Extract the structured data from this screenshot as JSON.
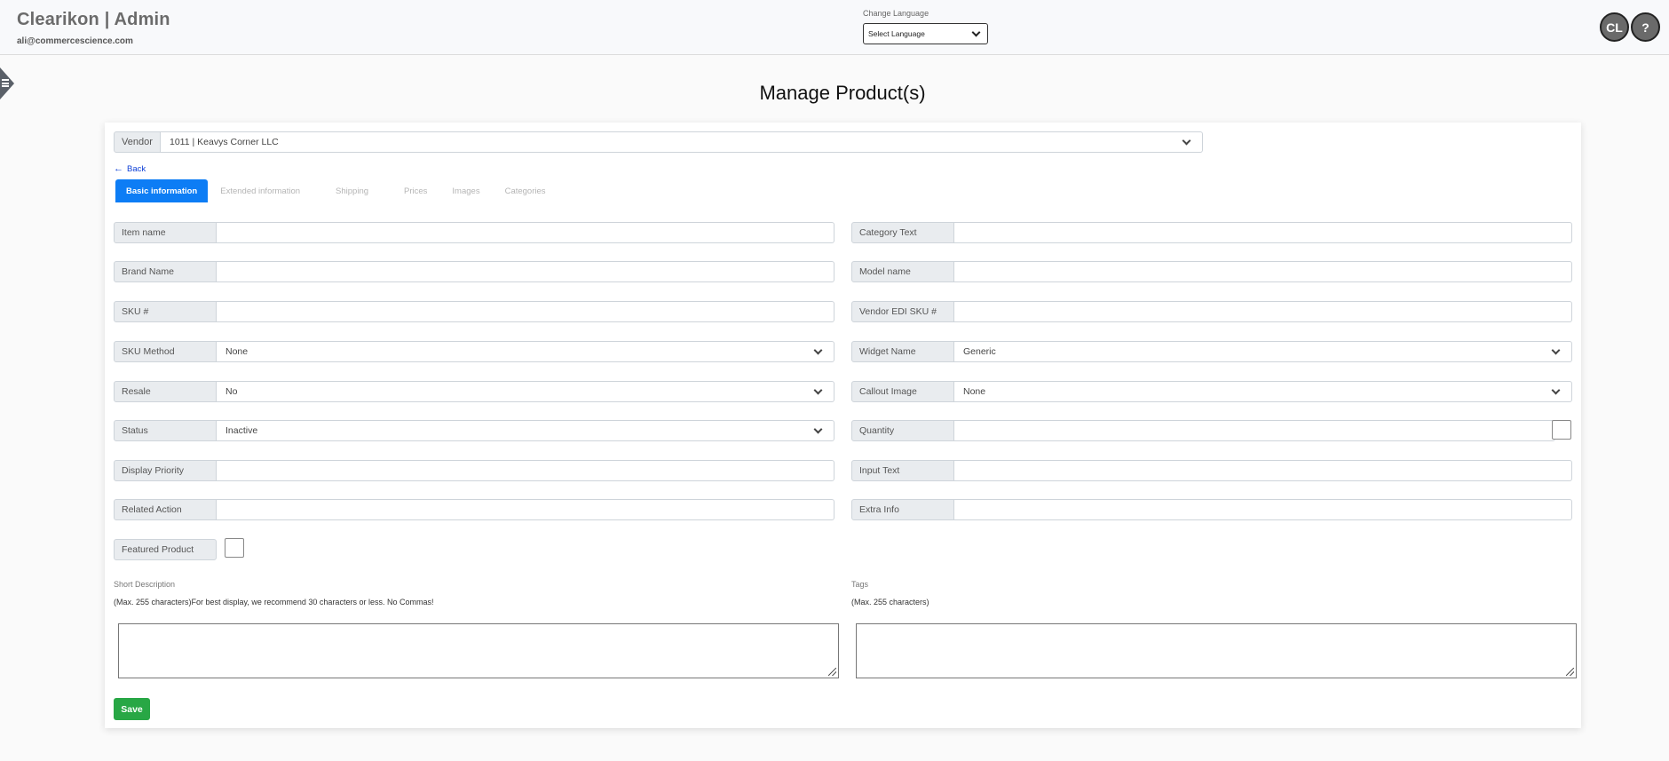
{
  "header": {
    "title": "Clearikon | Admin",
    "email": "ali@commercescience.com",
    "language_label": "Change Language",
    "language_select": "Select Language",
    "avatar_initials": "CL",
    "help_label": "?"
  },
  "page": {
    "title": "Manage Product(s)"
  },
  "vendor": {
    "label": "Vendor",
    "value": "1011 | Keavys Corner LLC"
  },
  "back_label": "Back",
  "tabs": [
    {
      "label": "Basic information",
      "active": true
    },
    {
      "label": "Extended information",
      "active": false
    },
    {
      "label": "Shipping",
      "active": false
    },
    {
      "label": "Prices",
      "active": false
    },
    {
      "label": "Images",
      "active": false
    },
    {
      "label": "Categories",
      "active": false
    }
  ],
  "fields_left": [
    {
      "label": "Item name",
      "type": "text",
      "value": ""
    },
    {
      "label": "Brand Name",
      "type": "text",
      "value": ""
    },
    {
      "label": "SKU #",
      "type": "text",
      "value": ""
    },
    {
      "label": "SKU Method",
      "type": "select",
      "value": "None"
    },
    {
      "label": "Resale",
      "type": "select",
      "value": "No"
    },
    {
      "label": "Status",
      "type": "select",
      "value": "Inactive"
    },
    {
      "label": "Display Priority",
      "type": "text",
      "value": ""
    },
    {
      "label": "Related Action",
      "type": "text",
      "value": ""
    }
  ],
  "fields_right": [
    {
      "label": "Category Text",
      "type": "text",
      "value": ""
    },
    {
      "label": "Model name",
      "type": "text",
      "value": ""
    },
    {
      "label": "Vendor EDI SKU #",
      "type": "text",
      "value": ""
    },
    {
      "label": "Widget Name",
      "type": "select",
      "value": "Generic"
    },
    {
      "label": "Callout Image",
      "type": "select",
      "value": "None"
    },
    {
      "label": "Quantity",
      "type": "text",
      "value": ""
    },
    {
      "label": "Input Text",
      "type": "text",
      "value": ""
    },
    {
      "label": "Extra Info",
      "type": "text",
      "value": ""
    }
  ],
  "featured_product": {
    "label": "Featured Product",
    "checked": false
  },
  "short_description": {
    "label": "Short Description",
    "help": "(Max. 255 characters)For best display, we recommend 30 characters or less. No Commas!",
    "value": ""
  },
  "tags": {
    "label": "Tags",
    "help": "(Max. 255 characters)",
    "value": ""
  },
  "save_label": "Save",
  "colors": {
    "primary": "#0d7df5",
    "success": "#28a745",
    "link": "#0d3fd6"
  }
}
